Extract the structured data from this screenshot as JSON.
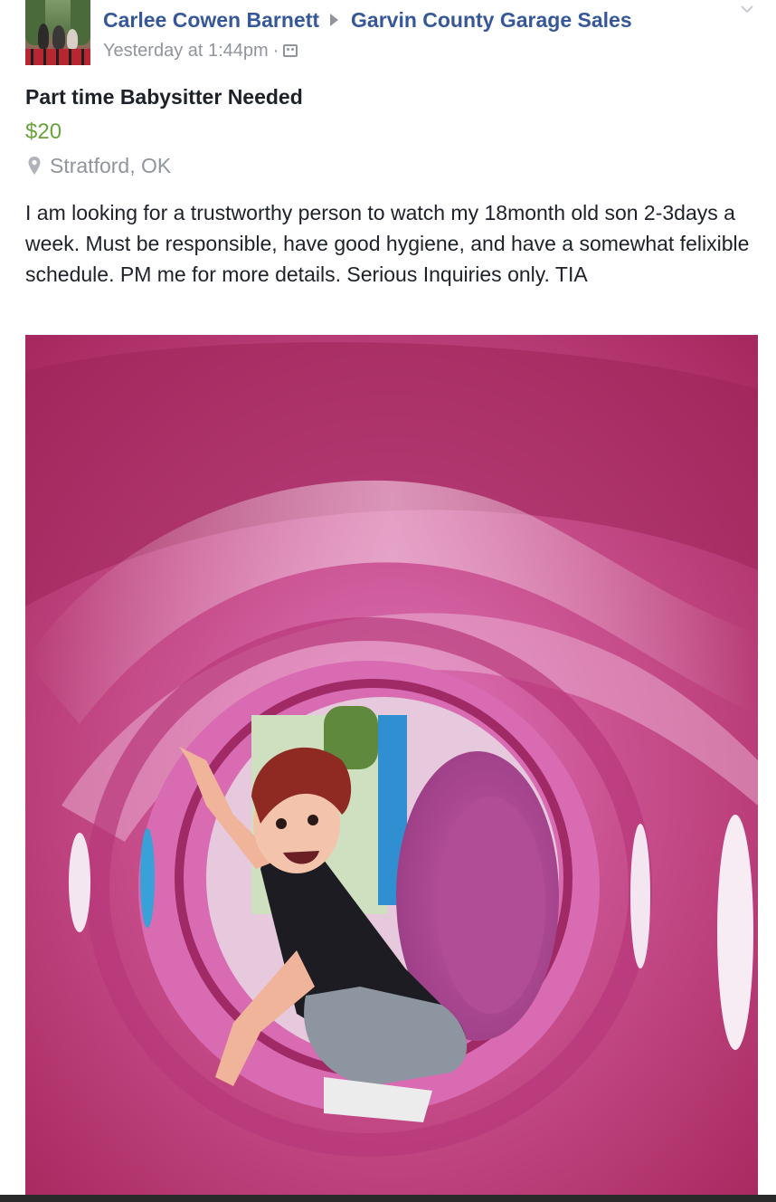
{
  "post": {
    "author": "Carlee Cowen Barnett",
    "group": "Garvin County Garage Sales",
    "timestamp": "Yesterday at 1:44pm",
    "separator": "·",
    "audience_icon": "group-members-icon",
    "options_icon": "chevron-down-icon"
  },
  "listing": {
    "title": "Part time Babysitter Needed",
    "price": "$20",
    "location": "Stratford, OK",
    "location_icon": "map-pin-icon",
    "description": "I am looking for a trustworthy person to watch my 18month old son 2-3days a week. Must be responsible, have good hygiene, and have a somewhat felixible schedule. PM me for more details. Serious Inquiries only. TIA"
  },
  "colors": {
    "link": "#365899",
    "price": "#6aa33b",
    "meta": "#90949c",
    "text": "#1d2129"
  }
}
